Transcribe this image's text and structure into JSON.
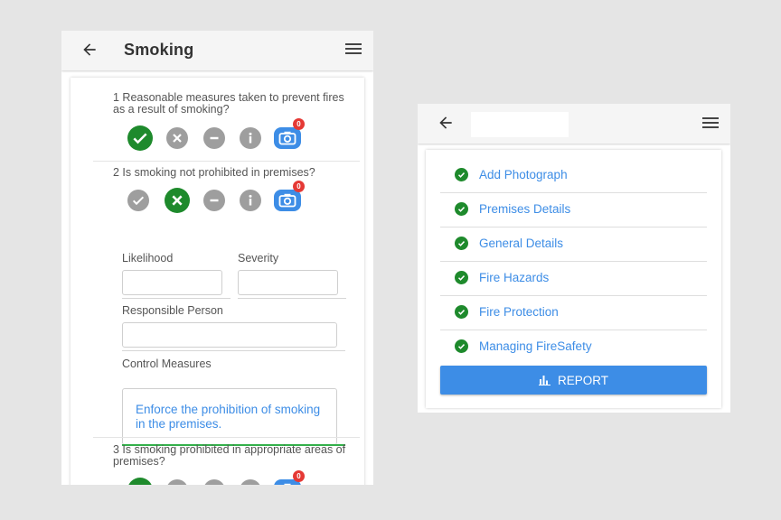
{
  "left_screen": {
    "title": "Smoking",
    "questions": [
      {
        "text": "1 Reasonable measures taken to prevent fires as a result of smoking?",
        "selected": "yes",
        "photo_count": "0"
      },
      {
        "text": "2 Is smoking not prohibited in premises?",
        "selected": "no",
        "photo_count": "0"
      },
      {
        "text": "3 Is smoking prohibited in appropriate areas of premises?",
        "selected": "yes",
        "photo_count": "0"
      }
    ],
    "fields": {
      "likelihood_label": "Likelihood",
      "likelihood_value": "",
      "severity_label": "Severity",
      "severity_value": "",
      "responsible_label": "Responsible Person",
      "responsible_value": "",
      "control_label": "Control Measures",
      "control_value": "Enforce the prohibition of smoking in the premises."
    }
  },
  "right_screen": {
    "title": "",
    "items": [
      {
        "label": "Add Photograph"
      },
      {
        "label": "Premises Details"
      },
      {
        "label": "General Details"
      },
      {
        "label": "Fire Hazards"
      },
      {
        "label": "Fire Protection"
      },
      {
        "label": "Managing FireSafety"
      }
    ],
    "report_label": "REPORT"
  },
  "colors": {
    "accent": "#3d8de6",
    "success": "#1e8a2c",
    "neutral": "#9e9e9e",
    "badge": "#e53935",
    "focus": "#33b04a"
  }
}
